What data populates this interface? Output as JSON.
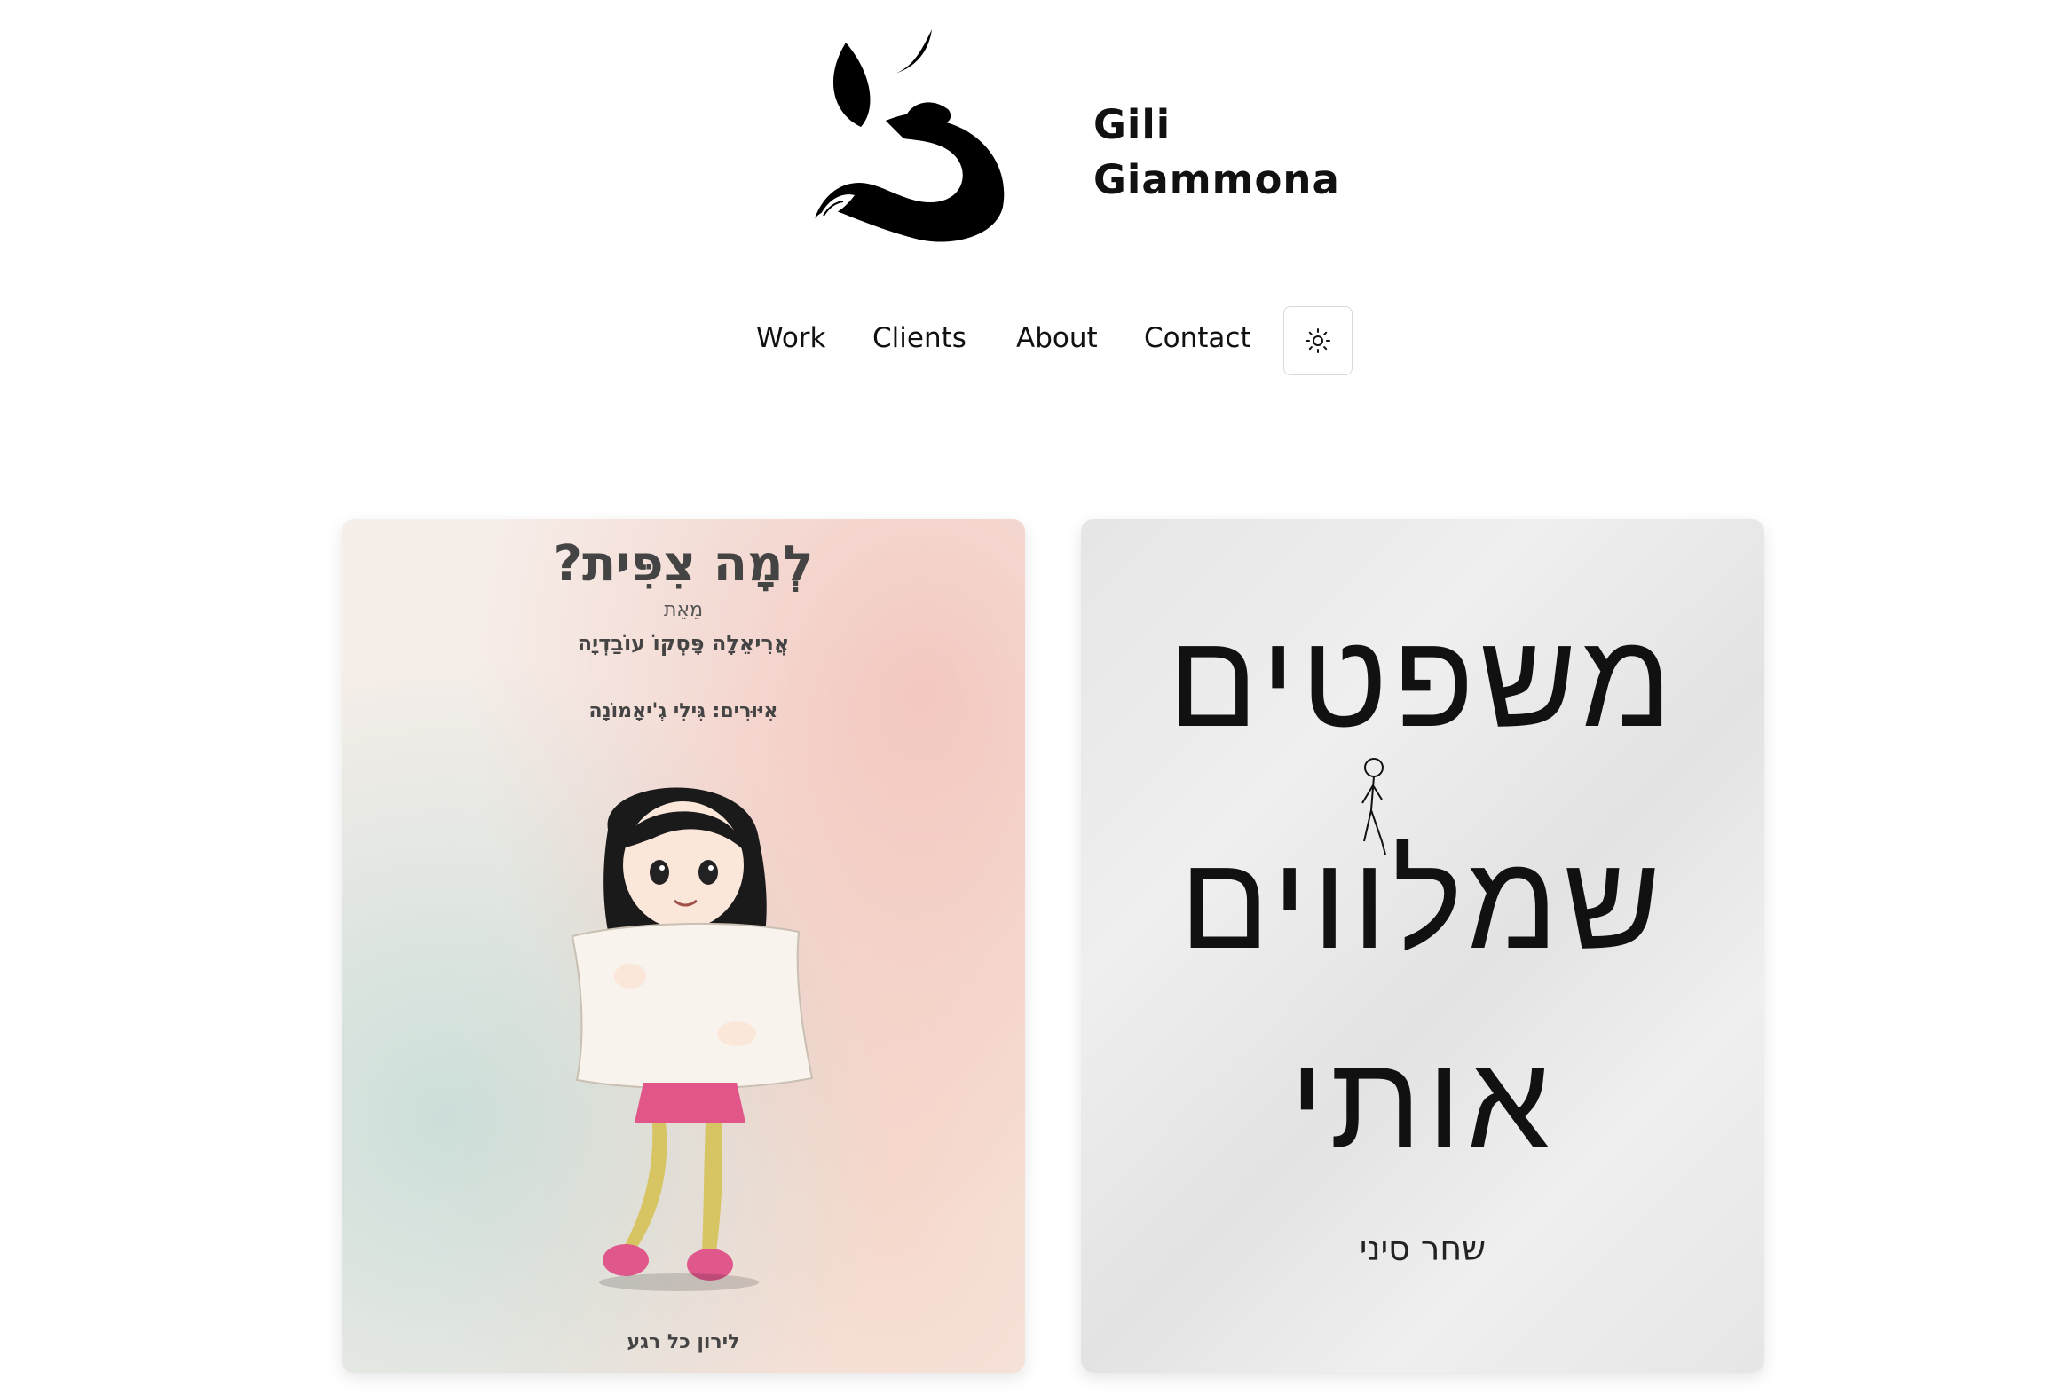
{
  "site": {
    "brand_line1": "Gili",
    "brand_line2": "Giammona"
  },
  "nav": {
    "items": [
      "Work",
      "Clients",
      "About",
      "Contact"
    ],
    "theme_toggle_icon": "sun-icon"
  },
  "cards": [
    {
      "title": "לְמָה צִפִּית?",
      "by_label": "מֵאֵת",
      "author": "אֲרִיאֵלָה פָּסְקוֹ עוֹבַדְיָה",
      "illustrator": "אִיּוּרִים: גִּילִי גְ'יאָמוֹנָה",
      "publisher": "לירון כל רגע",
      "illustration": "girl-hugging-pillow"
    },
    {
      "title_line1": "משפטים",
      "title_line2": "שמלווים",
      "title_line3": "אותי",
      "author": "שחר סיני",
      "illustration": "stick-figure-walking"
    }
  ]
}
